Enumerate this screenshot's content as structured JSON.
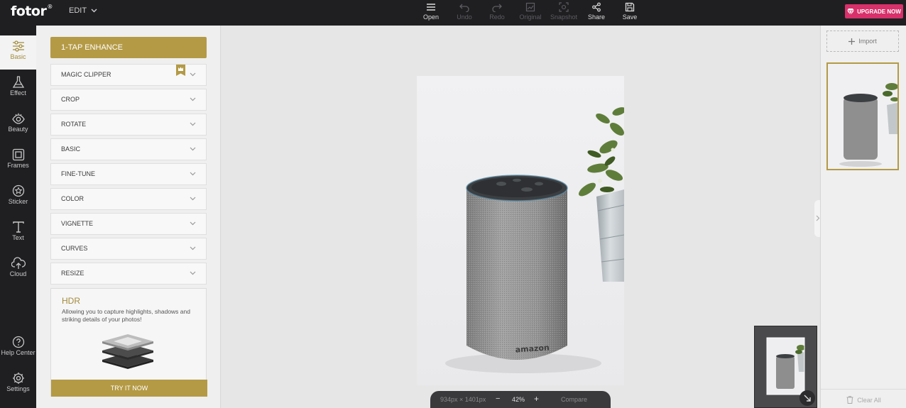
{
  "app": {
    "logo": "fotor",
    "logo_mark": "®",
    "menu_label": "EDIT"
  },
  "toolbar": [
    {
      "label": "Open",
      "icon": "menu-icon",
      "enabled": true
    },
    {
      "label": "Undo",
      "icon": "undo-icon",
      "enabled": false
    },
    {
      "label": "Redo",
      "icon": "redo-icon",
      "enabled": false
    },
    {
      "label": "Original",
      "icon": "original-icon",
      "enabled": false
    },
    {
      "label": "Snapshot",
      "icon": "snapshot-icon",
      "enabled": false
    },
    {
      "label": "Share",
      "icon": "share-icon",
      "enabled": true
    },
    {
      "label": "Save",
      "icon": "save-icon",
      "enabled": true
    }
  ],
  "upgrade": {
    "label": "UPGRADE NOW",
    "color": "#d8306a"
  },
  "nav": {
    "items": [
      {
        "label": "Basic",
        "icon": "sliders-icon"
      },
      {
        "label": "Effect",
        "icon": "flask-icon"
      },
      {
        "label": "Beauty",
        "icon": "eye-icon"
      },
      {
        "label": "Frames",
        "icon": "frame-icon"
      },
      {
        "label": "Sticker",
        "icon": "star-icon"
      },
      {
        "label": "Text",
        "icon": "text-icon"
      },
      {
        "label": "Cloud",
        "icon": "cloud-upload-icon"
      }
    ],
    "bottom": [
      {
        "label": "Help Center",
        "icon": "help-icon"
      },
      {
        "label": "Settings",
        "icon": "gear-icon"
      }
    ],
    "active": "Basic"
  },
  "panel": {
    "enhance": "1-TAP ENHANCE",
    "sections": [
      "MAGIC CLIPPER",
      "CROP",
      "ROTATE",
      "BASIC",
      "FINE-TUNE",
      "COLOR",
      "VIGNETTE",
      "CURVES",
      "RESIZE"
    ],
    "hdr": {
      "title": "HDR",
      "description": "Allowing you to capture highlights, shadows and striking details of your photos!",
      "button": "TRY IT NOW"
    }
  },
  "canvas": {
    "dimensions": "934px × 1401px",
    "zoom": "42%",
    "zoom_out": "−",
    "zoom_in": "+",
    "compare": "Compare",
    "product_text": "amazon"
  },
  "right": {
    "import": "Import",
    "clear_all": "Clear All"
  },
  "colors": {
    "accent": "#b49a45",
    "dark": "#1f1f22",
    "upgrade": "#d8306a"
  }
}
